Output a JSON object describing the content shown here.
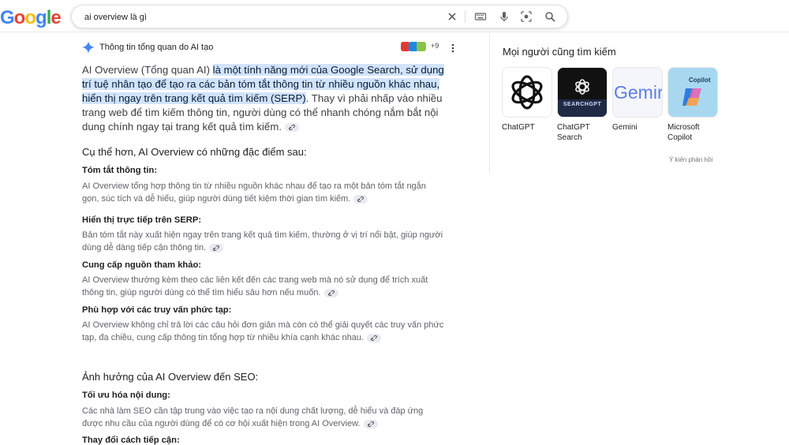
{
  "header": {
    "logo": "Google",
    "search_value": "ai overview là gì"
  },
  "ai_overview": {
    "title": "Thông tin tổng quan do AI tạo",
    "sources_more": "+9",
    "lead_plain_1": "AI Overview (Tổng quan AI) ",
    "lead_highlight": "là một tính năng mới của Google Search, sử dụng trí tuệ nhân tạo để tạo ra các bản tóm tắt thông tin từ nhiều nguồn khác nhau, hiển thị ngay trên trang kết quả tìm kiếm (SERP)",
    "lead_plain_2": ". Thay vì phải nhấp vào nhiều trang web để tìm kiếm thông tin, người dùng có thể nhanh chóng nắm bắt nội dung chính ngay tại trang kết quả tìm kiếm.",
    "section1_title": "Cụ thể hơn, AI Overview có những đặc điểm sau:",
    "items": [
      {
        "title": "Tóm tắt thông tin:",
        "text": "AI Overview tổng hợp thông tin từ nhiều nguồn khác nhau để tạo ra một bản tóm tắt ngắn gọn, súc tích và dễ hiểu, giúp người dùng tiết kiệm thời gian tìm kiếm."
      },
      {
        "title": "Hiển thị trực tiếp trên SERP:",
        "text": "Bản tóm tắt này xuất hiện ngay trên trang kết quả tìm kiếm, thường ở vị trí nổi bật, giúp người dùng dễ dàng tiếp cận thông tin."
      },
      {
        "title": "Cung cấp nguồn tham khảo:",
        "text": "AI Overview thường kèm theo các liên kết đến các trang web mà nó sử dụng để trích xuất thông tin, giúp người dùng có thể tìm hiểu sâu hơn nếu muốn."
      },
      {
        "title": "Phù hợp với các truy vấn phức tạp:",
        "text": "AI Overview không chỉ trả lời các câu hỏi đơn giản mà còn có thể giải quyết các truy vấn phức tạp, đa chiều, cung cấp thông tin tổng hợp từ nhiều khía cạnh khác nhau."
      }
    ],
    "section2_title": "Ảnh hưởng của AI Overview đến SEO:",
    "items2": [
      {
        "title": "Tối ưu hóa nội dung:",
        "text": "Các nhà làm SEO cần tập trung vào việc tạo ra nội dung chất lượng, dễ hiểu và đáp ứng được nhu cầu của người dùng để có cơ hội xuất hiện trong AI Overview."
      },
      {
        "title": "Thay đổi cách tiếp cận:",
        "text": ""
      }
    ]
  },
  "related": {
    "title": "Mọi người cũng tìm kiếm",
    "cards": [
      {
        "label": "ChatGPT"
      },
      {
        "label": "ChatGPT Search",
        "thumb_text": "SEARCHGPT"
      },
      {
        "label": "Gemini",
        "thumb_text": "Gemir"
      },
      {
        "label": "Microsoft Copilot",
        "thumb_text": "Copilot"
      }
    ],
    "feedback": "Ý kiến phản hồi"
  },
  "colors": {
    "highlight": "#d3e3fd",
    "ai_sparkle": "#4285f4"
  }
}
